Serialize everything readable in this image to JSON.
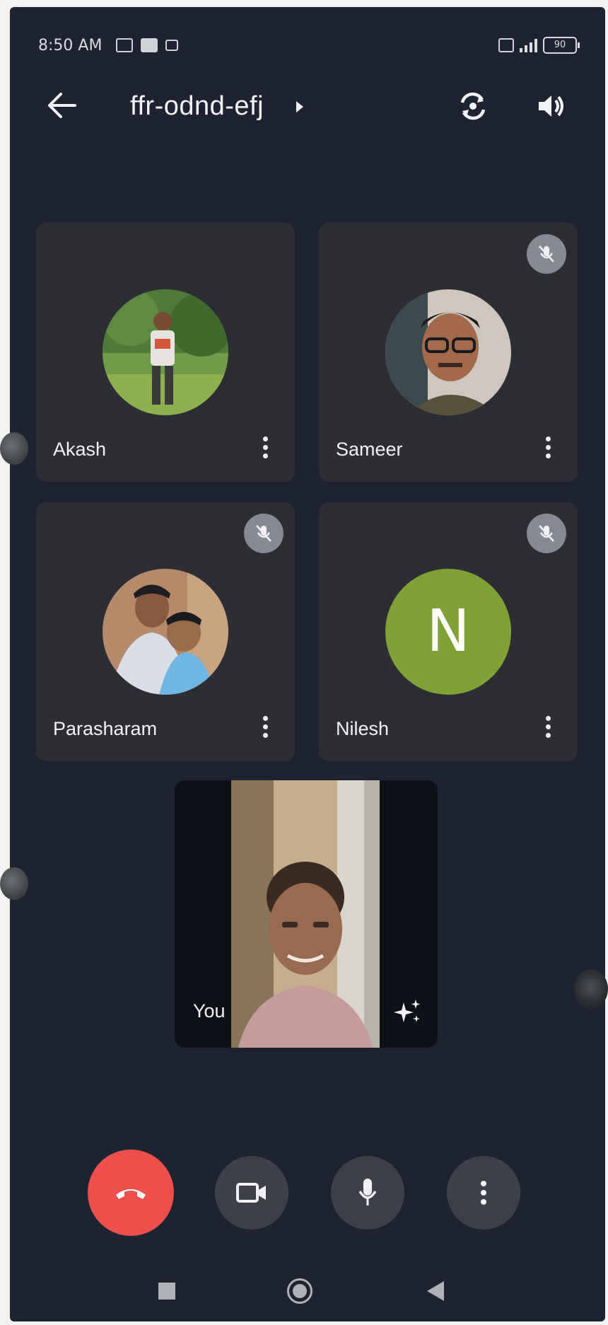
{
  "status_bar": {
    "time": "8:50 AM",
    "battery": "90"
  },
  "header": {
    "meeting_code": "ffr-odnd-efj",
    "back_icon": "arrow-left-icon",
    "switch_camera_icon": "camera-switch-icon",
    "audio_icon": "speaker-icon"
  },
  "participants": [
    {
      "name": "Akash",
      "muted": false,
      "avatar": "photo"
    },
    {
      "name": "Sameer",
      "muted": true,
      "avatar": "photo"
    },
    {
      "name": "Parasharam",
      "muted": true,
      "avatar": "photo"
    },
    {
      "name": "Nilesh",
      "muted": true,
      "avatar": "initial",
      "initial": "N",
      "color": "#7ea236"
    }
  ],
  "self_view": {
    "label": "You",
    "effects_icon": "sparkle-icon"
  },
  "controls": {
    "end_call_icon": "phone-hangup-icon",
    "camera_icon": "video-camera-icon",
    "mic_icon": "microphone-icon",
    "more_icon": "more-vert-icon",
    "end_color": "#ec4f4c"
  },
  "nav": {
    "recents_icon": "square-icon",
    "home_icon": "circle-icon",
    "back_icon": "triangle-back-icon"
  }
}
